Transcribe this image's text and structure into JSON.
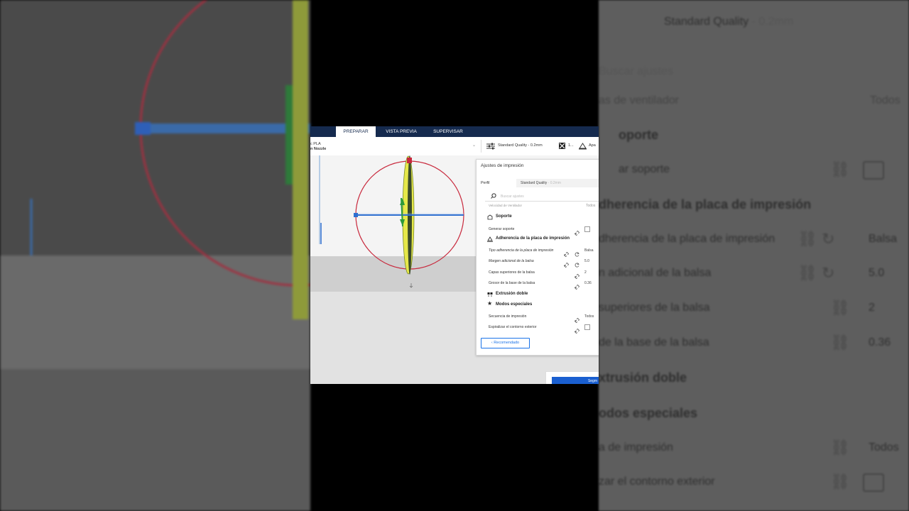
{
  "nav": {
    "tabs": [
      {
        "label": "PREPARAR",
        "active": true
      },
      {
        "label": "VISTA PREVIA",
        "active": false
      },
      {
        "label": "SUPERVISAR",
        "active": false
      }
    ]
  },
  "toolbar": {
    "material_line1": "c PLA",
    "material_line2": "n Nozzle",
    "quality": "Standard Quality - 0.2mm",
    "support_value": "1...",
    "adhesion_value": "Apa"
  },
  "panel": {
    "title": "Ajustes de impresión",
    "profile_label": "Perfil",
    "profile_value": "Standard Quality",
    "profile_suffix": " - 0.2mm",
    "search_placeholder": "Buscar ajustes",
    "partial_row_label": "Velocidad de Ventilador",
    "partial_row_value": "Todos",
    "sections": {
      "support": "Soporte",
      "adhesion": "Adherencia de la placa de impresión",
      "dual": "Extrusión doble",
      "special": "Modos especiales"
    },
    "settings": {
      "generate_support": "Generar soporte",
      "adhesion_type": "Tipo adherencia de la placa de impresión",
      "adhesion_type_value": "Balsa",
      "raft_margin": "Margen adicional de la balsa",
      "raft_margin_value": "5.0",
      "raft_top_layers": "Capas superiores de la balsa",
      "raft_top_layers_value": "2",
      "raft_base_thickness": "Grosor de la base de la balsa",
      "raft_base_thickness_value": "0.36",
      "print_sequence": "Secuencia de impresión",
      "print_sequence_value": "Todos",
      "spiralize": "Espiralizar el contorno exterior"
    },
    "recommended_button": "Recomendado"
  },
  "slice_button": "Segm",
  "right_bg": {
    "quality": "Standard Quality",
    "quality_suffix": " - 0.2mm",
    "search": "Buscar ajustes",
    "fan": "as de ventilador",
    "fan_value": "Todos",
    "support": "oporte",
    "generate_support": "ar soporte",
    "adhesion": "dherencia de la placa de impresión",
    "adhesion_type": "dherencia de la placa de impresión",
    "adhesion_type_value": "Balsa",
    "raft_margin": "n adicional de la balsa",
    "raft_margin_value": "5.0",
    "raft_top_layers": "superiores de la balsa",
    "raft_top_layers_value": "2",
    "raft_base_thickness": "de la base de la balsa",
    "raft_base_thickness_value": "0.36",
    "dual": "xtrusión doble",
    "special": "odos especiales",
    "print_sequence": "a de impresión",
    "print_sequence_value": "Todos",
    "spiralize": "zar el contorno exterior"
  },
  "colors": {
    "nav_bg": "#152a4e",
    "accent": "#1a73e8",
    "rotate_red": "#c8283c",
    "rotate_blue": "#2e6fd0",
    "rotate_green": "#2e9a3a",
    "model_yellow": "#e6e84a"
  }
}
